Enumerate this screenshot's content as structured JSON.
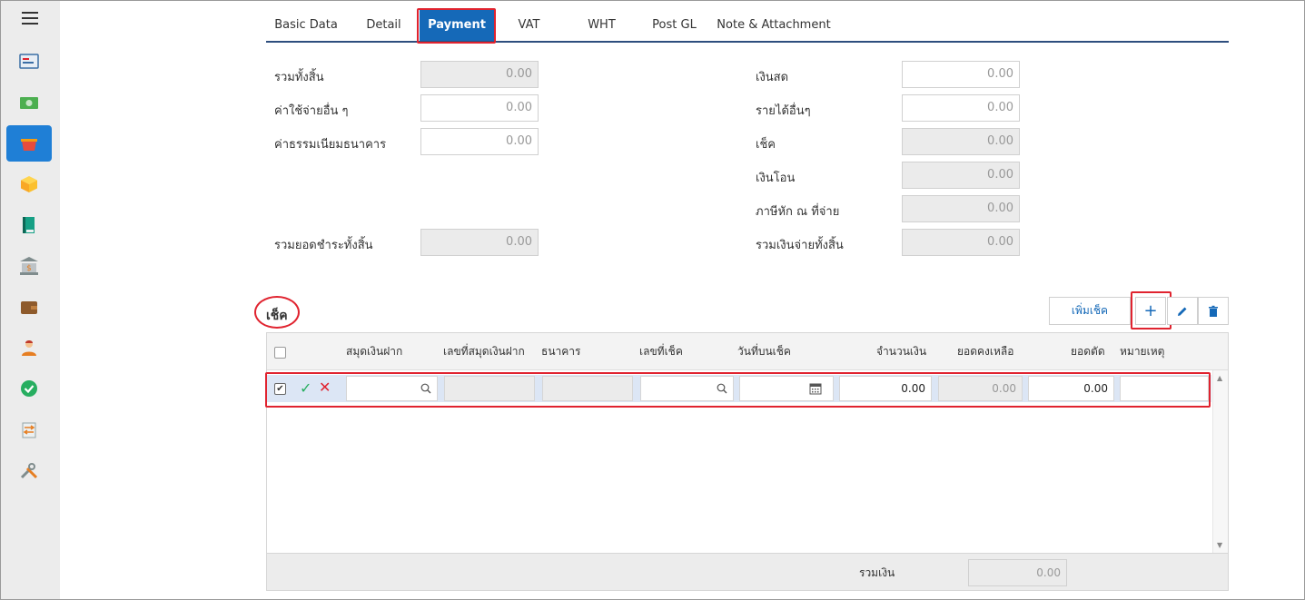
{
  "tabs": [
    "Basic Data",
    "Detail",
    "Payment",
    "VAT",
    "WHT",
    "Post GL",
    "Note & Attachment"
  ],
  "left_form": {
    "total_label": "รวมทั้งสิ้น",
    "total_value": "0.00",
    "other_expense_label": "ค่าใช้จ่ายอื่น ๆ",
    "other_expense_value": "0.00",
    "bank_fee_label": "ค่าธรรมเนียมธนาคาร",
    "bank_fee_value": "0.00",
    "total_paid_label": "รวมยอดชำระทั้งสิ้น",
    "total_paid_value": "0.00"
  },
  "right_form": {
    "cash_label": "เงินสด",
    "cash_value": "0.00",
    "other_income_label": "รายได้อื่นๆ",
    "other_income_value": "0.00",
    "cheque_label": "เช็ค",
    "cheque_value": "0.00",
    "transfer_label": "เงินโอน",
    "transfer_value": "0.00",
    "wht_label": "ภาษีหัก ณ ที่จ่าย",
    "wht_value": "0.00",
    "total_payment_label": "รวมเงินจ่ายทั้งสิ้น",
    "total_payment_value": "0.00"
  },
  "cheque_section": {
    "title": "เช็ค",
    "add_cheque_label": "เพิ่มเช็ค",
    "add_icon": "plus-icon",
    "edit_icon": "pencil-icon",
    "delete_icon": "trash-icon",
    "columns": [
      "สมุดเงินฝาก",
      "เลขที่สมุดเงินฝาก",
      "ธนาคาร",
      "เลขที่เช็ค",
      "วันที่บนเช็ค",
      "จำนวนเงิน",
      "ยอดคงเหลือ",
      "ยอดตัด",
      "หมายเหตุ"
    ],
    "row": {
      "amount": "0.00",
      "balance": "0.00",
      "cut_amount": "0.00"
    },
    "footer_label": "รวมเงิน",
    "footer_value": "0.00"
  },
  "colors": {
    "accent": "#1569b8",
    "highlight": "#e0232f",
    "sidebar_active": "#1f7fd6"
  },
  "sidebar_icons": [
    "dashboard-icon",
    "money-icon",
    "basket-icon",
    "box-icon",
    "book-icon",
    "bank-icon",
    "wallet-icon",
    "user-icon",
    "check-circle-icon",
    "transfer-icon",
    "tools-icon"
  ]
}
